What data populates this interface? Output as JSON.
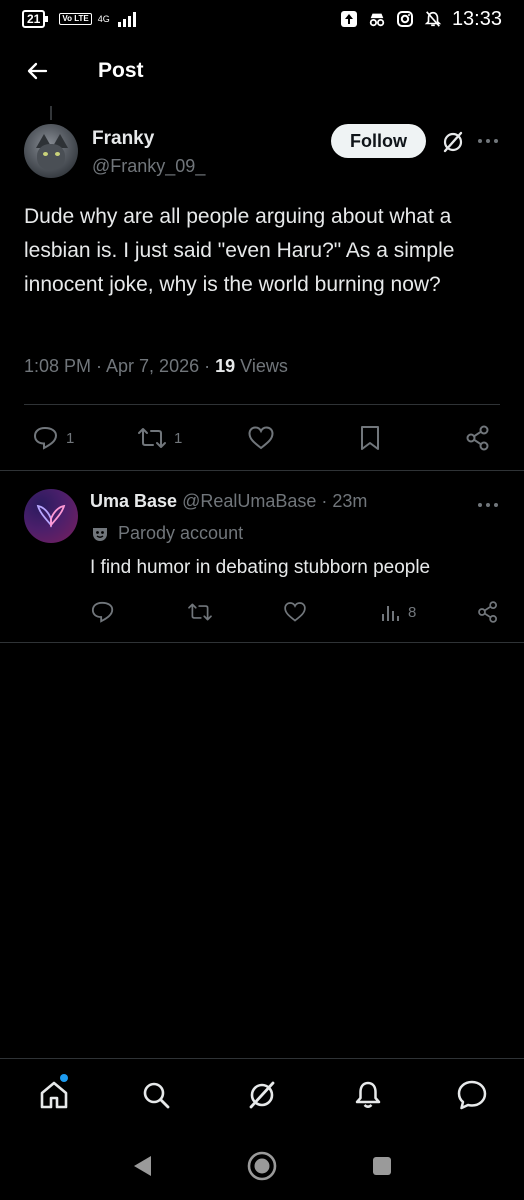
{
  "status_bar": {
    "battery": "21",
    "volte": "Vo LTE",
    "network": "4G",
    "time": "13:33"
  },
  "header": {
    "title": "Post"
  },
  "post": {
    "author_name": "Franky",
    "author_handle": "@Franky_09_",
    "follow_label": "Follow",
    "text": "Dude why are all people arguing about what a lesbian is. I just said \"even Haru?\" As a simple innocent joke, why is the world burning now?",
    "meta_time": "1:08 PM · Apr 7, 2026 · ",
    "views_count": "19",
    "views_label": " Views",
    "replies": "1",
    "reposts": "1"
  },
  "reply": {
    "name": "Uma Base",
    "handle": "@RealUmaBase",
    "time": " · 23m",
    "parody_label": "Parody account",
    "text": "I find humor in debating stubborn people",
    "views": "8"
  },
  "colors": {
    "background": "#000000",
    "text": "#e7e9ea",
    "secondary": "#71767b",
    "divider": "#2f3336",
    "accent": "#1d9bf0"
  }
}
